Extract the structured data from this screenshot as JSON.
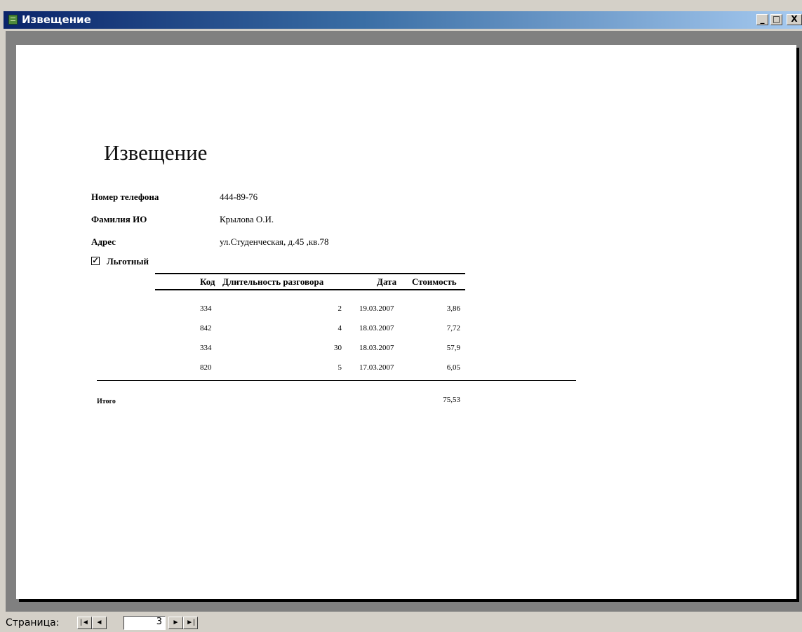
{
  "window": {
    "title": "Извещение",
    "minimize": "_",
    "maximize": "□",
    "close": "X"
  },
  "report": {
    "title": "Извещение",
    "fields": [
      {
        "label": "Номер телефона",
        "value": "444-89-76"
      },
      {
        "label": "Фамилия ИО",
        "value": "Крылова О.И."
      },
      {
        "label": "Адрес",
        "value": "ул.Студенческая, д.45 ,кв.78"
      }
    ],
    "checkbox": {
      "label": "Льготный",
      "checked": true,
      "mark": "✓"
    },
    "table": {
      "headers": [
        "Код",
        "Длительность разговора",
        "Дата",
        "Стоимость"
      ],
      "rows": [
        [
          "334",
          "2",
          "19.03.2007",
          "3,86"
        ],
        [
          "842",
          "4",
          "18.03.2007",
          "7,72"
        ],
        [
          "334",
          "30",
          "18.03.2007",
          "57,9"
        ],
        [
          "820",
          "5",
          "17.03.2007",
          "6,05"
        ]
      ]
    },
    "total_label": "Итого",
    "total_value": "75,53"
  },
  "nav": {
    "page_label": "Страница:",
    "first": "|◄",
    "prev": "◄",
    "page_number": "3",
    "next": "►",
    "last": "►|"
  }
}
